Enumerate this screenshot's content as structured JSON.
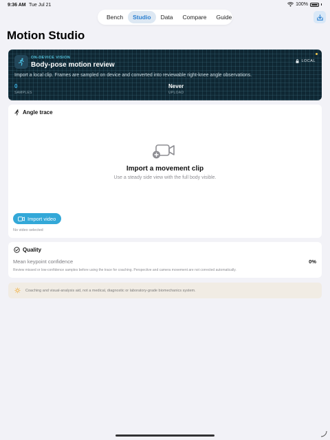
{
  "status": {
    "time": "9:36 AM",
    "date": "Tue Jul 21",
    "battery": "100%"
  },
  "nav": {
    "tabs": [
      "Bench",
      "Studio",
      "Data",
      "Compare",
      "Guide"
    ],
    "active": "Studio"
  },
  "page": {
    "title": "Motion Studio"
  },
  "hero": {
    "eyebrow": "ON-DEVICE VISION",
    "title": "Body-pose motion review",
    "badge": "LOCAL",
    "description": "Import a local clip. Frames are sampled on device and converted into reviewable right-knee angle observations.",
    "stats": [
      {
        "value": "0",
        "label": "SAMPLES"
      },
      {
        "value": "Never",
        "label": "UPLOAD"
      }
    ]
  },
  "trace": {
    "heading": "Angle trace",
    "empty_title": "Import a movement clip",
    "empty_subtitle": "Use a steady side view with the full body visible.",
    "import_label": "Import video",
    "status": "No video selected"
  },
  "quality": {
    "heading": "Quality",
    "metric_label": "Mean keypoint confidence",
    "metric_value": "0%",
    "note": "Review missed or low-confidence samples before using the trace for coaching. Perspective and camera movement are not corrected automatically."
  },
  "disclaimer": "Coaching and visual-analysis aid, not a medical, diagnostic or laboratory-grade biomechanics system.",
  "icons": {
    "hero": "running-figure-icon",
    "trace": "running-figure-icon",
    "empty": "video-add-icon",
    "import": "video-icon",
    "quality": "checkmark-seal-icon",
    "disclaimer": "sun-icon",
    "export": "tray-download-icon",
    "local": "lock-icon"
  },
  "colors": {
    "accent": "#33a8d8",
    "hero_bg": "#0f2733",
    "active_tab_text": "#2a7fd0"
  }
}
